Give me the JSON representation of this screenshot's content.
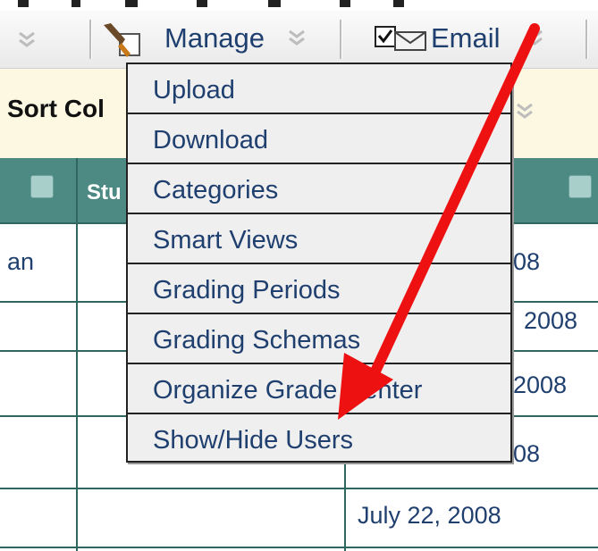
{
  "toolbar": {
    "manage_label": "Manage",
    "email_label": "Email"
  },
  "sortbar": {
    "label": "Sort Col"
  },
  "table": {
    "header_student_fragment": "Stu",
    "rows": [
      {
        "left": "an",
        "date": "08"
      },
      {
        "left": "",
        "date": "2008"
      },
      {
        "left": "",
        "date": "2008"
      },
      {
        "left": "",
        "date": "08"
      },
      {
        "left": "",
        "date": "July 22, 2008"
      }
    ]
  },
  "manage_menu": {
    "items": [
      "Upload",
      "Download",
      "Categories",
      "Smart Views",
      "Grading Periods",
      "Grading Schemas",
      "Organize Grade Center",
      "Show/Hide Users"
    ]
  },
  "colors": {
    "toolbar_bg": "#ececec",
    "sortbar_bg": "#fdf8e1",
    "header_teal": "#4d8a84",
    "grid_line": "#2f6660",
    "text_blue": "#1f3f6f",
    "menu_bg": "#efefef",
    "arrow_red": "#ee1111"
  },
  "icons": {
    "manage": "wrench-tool-icon",
    "email": "checkbox-envelope-icon",
    "chevron": "double-chevron-down-icon"
  }
}
